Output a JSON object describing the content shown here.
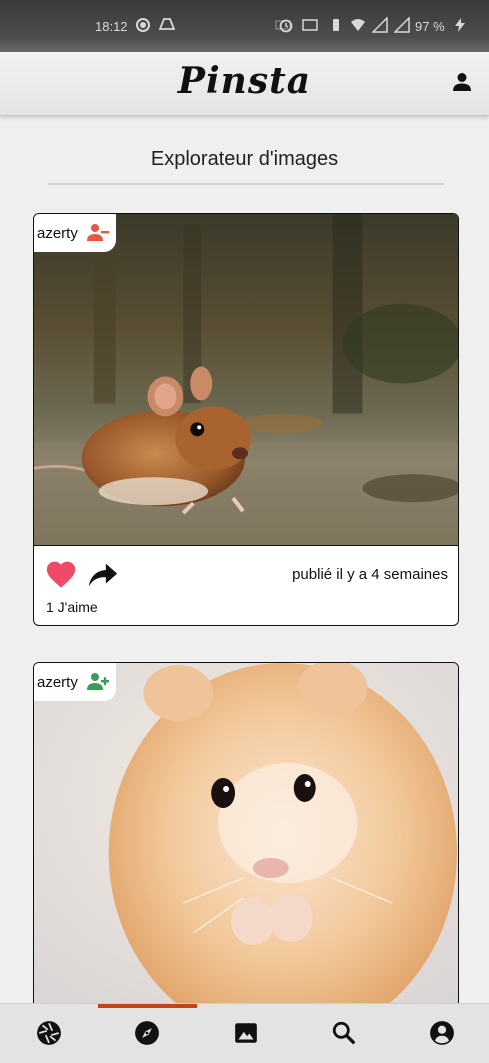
{
  "status_bar": {
    "time": "18:12",
    "battery": "97 %",
    "icons": [
      "record-icon",
      "drive-icon",
      "data-speed-icon",
      "alarm-icon",
      "cast-icon",
      "vibrate-icon",
      "wifi-icon",
      "signal-icon",
      "signal-icon",
      "charging-icon"
    ]
  },
  "header": {
    "app_name": "Pinsta",
    "profile_icon": "person-icon"
  },
  "page": {
    "title": "Explorateur d'images"
  },
  "posts": [
    {
      "author": "azerty",
      "follow_state": "remove-person-icon",
      "follow_color": "#e8573f",
      "image": "brown mouse photo",
      "liked": true,
      "like_color": "#f04a6a",
      "posted": "publié il y a 4 semaines",
      "likes": "1 J'aime"
    },
    {
      "author": "azerty",
      "follow_state": "add-person-icon",
      "follow_color": "#3d9a58",
      "image": "hamster photo"
    }
  ],
  "bottom_nav": {
    "items": [
      "aperture-icon",
      "compass-icon",
      "image-icon",
      "search-icon",
      "account-icon"
    ],
    "active_index": 1,
    "active_color": "#c0441e"
  }
}
